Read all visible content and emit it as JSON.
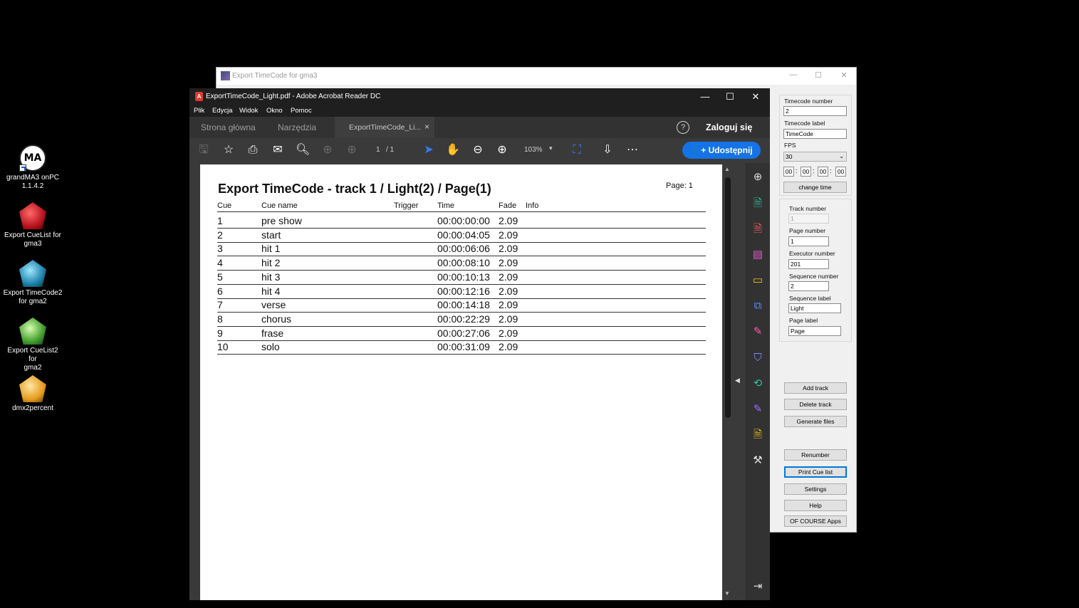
{
  "desktop": {
    "icons": [
      {
        "label": "grandMA3 onPC\n1.1.4.2",
        "icon": "grandma3-icon"
      },
      {
        "label": "Export CueList for\ngma3",
        "icon": "export-cuelist-icon"
      },
      {
        "label": "Export TimeCode2\nfor gma2",
        "icon": "export-timecode2-icon"
      },
      {
        "label": "Export CueList2 for\ngma2",
        "icon": "export-cuelist2-icon"
      },
      {
        "label": "dmx2percent",
        "icon": "dmx2percent-icon"
      }
    ],
    "ma_logo_text": "MA"
  },
  "tc_window": {
    "title": "Export TimeCode for gma3",
    "controls": {
      "minimize": "—",
      "maximize": "☐",
      "close": "✕"
    },
    "timecode_number_label": "Timecode number",
    "timecode_number": "2",
    "timecode_label_label": "Timecode label",
    "timecode_label": "TimeCode",
    "fps_label": "FPS",
    "fps": "30",
    "time": [
      "00",
      "00",
      "00",
      "00"
    ],
    "time_sep": ":",
    "change_time": "change time",
    "track_number_label": "Track number",
    "track_number": "1",
    "page_number_label": "Page number",
    "page_number": "1",
    "executor_number_label": "Executor number",
    "executor_number": "201",
    "sequence_number_label": "Sequence number",
    "sequence_number": "2",
    "sequence_label_label": "Sequence label",
    "sequence_label": "Light",
    "page_label_label": "Page label",
    "page_label": "Page",
    "buttons": {
      "add_track": "Add track",
      "delete_track": "Delete track",
      "generate_files": "Generate files",
      "renumber": "Renumber",
      "print_cue_list": "Print Cue list",
      "settings": "Settings",
      "help": "Help",
      "of_course_apps": "OF COURSE Apps"
    }
  },
  "acrobat": {
    "title": "ExportTimeCode_Light.pdf - Adobe Acrobat Reader DC",
    "controls": {
      "minimize": "—",
      "maximize": "☐",
      "close": "✕"
    },
    "menu": [
      "Plik",
      "Edycja",
      "Widok",
      "Okno",
      "Pomoc"
    ],
    "tabs": {
      "home": "Strona główna",
      "tools": "Narzędzia",
      "doc": "ExportTimeCode_Li...",
      "doc_close": "×"
    },
    "help_icon": "?",
    "sign_in": "Zaloguj się",
    "page_indicator": "1",
    "page_total": "/ 1",
    "zoom": "103%",
    "share": "Udostępnij"
  },
  "pdf": {
    "title": "Export TimeCode - track 1 / Light(2) / Page(1)",
    "page_label": "Page: 1",
    "columns": {
      "cue": "Cue",
      "cue_name": "Cue name",
      "trigger": "Trigger",
      "time": "Time",
      "fade": "Fade",
      "info": "Info"
    },
    "rows": [
      {
        "cue": "1",
        "name": "pre show",
        "time": "00:00:00:00",
        "fade": "2.09"
      },
      {
        "cue": "2",
        "name": "start",
        "time": "00:00:04:05",
        "fade": "2.09"
      },
      {
        "cue": "3",
        "name": "hit 1",
        "time": "00:00:06:06",
        "fade": "2.09"
      },
      {
        "cue": "4",
        "name": "hit 2",
        "time": "00:00:08:10",
        "fade": "2.09"
      },
      {
        "cue": "5",
        "name": "hit 3",
        "time": "00:00:10:13",
        "fade": "2.09"
      },
      {
        "cue": "6",
        "name": "hit 4",
        "time": "00:00:12:16",
        "fade": "2.09"
      },
      {
        "cue": "7",
        "name": "verse",
        "time": "00:00:14:18",
        "fade": "2.09"
      },
      {
        "cue": "8",
        "name": "chorus",
        "time": "00:00:22:29",
        "fade": "2.09"
      },
      {
        "cue": "9",
        "name": "frase",
        "time": "00:00:27:06",
        "fade": "2.09"
      },
      {
        "cue": "10",
        "name": "solo",
        "time": "00:00:31:09",
        "fade": "2.09"
      }
    ]
  }
}
